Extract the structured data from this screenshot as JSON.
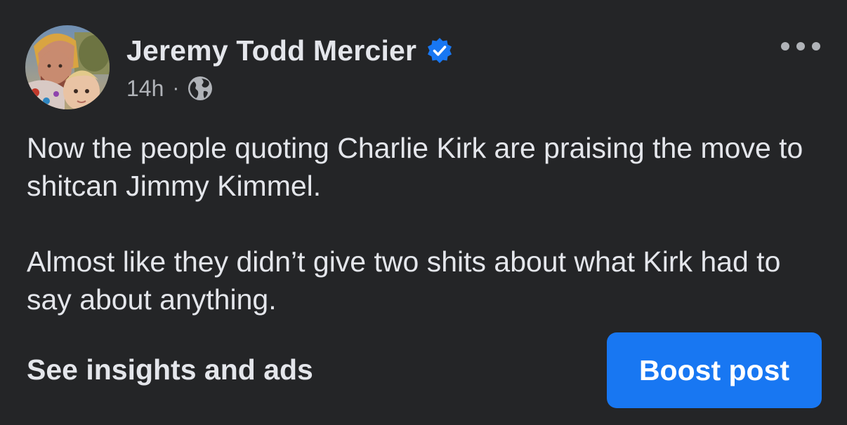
{
  "post": {
    "author": {
      "name": "Jeremy Todd Mercier",
      "verified": true,
      "avatar_icon": "profile-photo"
    },
    "timestamp": "14h",
    "separator": "·",
    "audience_icon": "globe-icon",
    "body": [
      "Now the people quoting Charlie Kirk are praising the move to shitcan Jimmy Kimmel.",
      "Almost like they didn’t give two shits about what Kirk had to say about anything."
    ],
    "insights_label": "See insights and ads",
    "boost_label": "Boost post",
    "more_icon": "more-options-icon"
  },
  "colors": {
    "background": "#242527",
    "primary_text": "#e4e6eb",
    "secondary_text": "#b0b3b8",
    "accent": "#1877f2",
    "verified_badge": "#1877f2"
  }
}
